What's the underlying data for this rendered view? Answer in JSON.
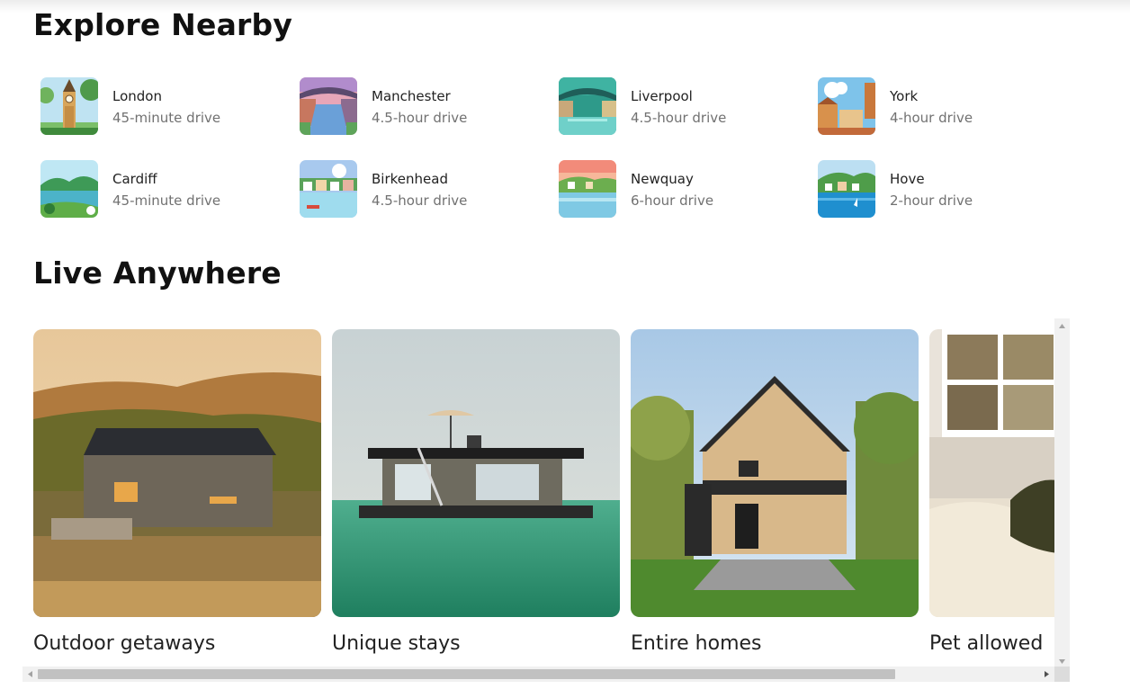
{
  "explore": {
    "title": "Explore Nearby",
    "items": [
      {
        "city": "London",
        "drive": "45-minute drive",
        "icon": "big-ben-thumbnail"
      },
      {
        "city": "Manchester",
        "drive": "4.5-hour drive",
        "icon": "bridge-canal-thumbnail"
      },
      {
        "city": "Liverpool",
        "drive": "4.5-hour drive",
        "icon": "bridge-river-thumbnail"
      },
      {
        "city": "York",
        "drive": "4-hour drive",
        "icon": "old-town-thumbnail"
      },
      {
        "city": "Cardiff",
        "drive": "45-minute drive",
        "icon": "lake-hills-thumbnail"
      },
      {
        "city": "Birkenhead",
        "drive": "4.5-hour drive",
        "icon": "harbour-houses-thumbnail"
      },
      {
        "city": "Newquay",
        "drive": "6-hour drive",
        "icon": "sunset-coast-thumbnail"
      },
      {
        "city": "Hove",
        "drive": "2-hour drive",
        "icon": "seaside-village-thumbnail"
      }
    ]
  },
  "live": {
    "title": "Live Anywhere",
    "cards": [
      {
        "label": "Outdoor getaways",
        "icon": "countryside-cabin-photo"
      },
      {
        "label": "Unique stays",
        "icon": "houseboat-photo"
      },
      {
        "label": "Entire homes",
        "icon": "a-frame-house-photo"
      },
      {
        "label": "Pet allowed",
        "icon": "dog-on-bed-photo"
      }
    ]
  },
  "colors": {
    "primary_text": "#222222",
    "secondary_text": "#717171",
    "scrollbar_track": "#f1f1f1",
    "scrollbar_thumb": "#c1c1c1"
  }
}
